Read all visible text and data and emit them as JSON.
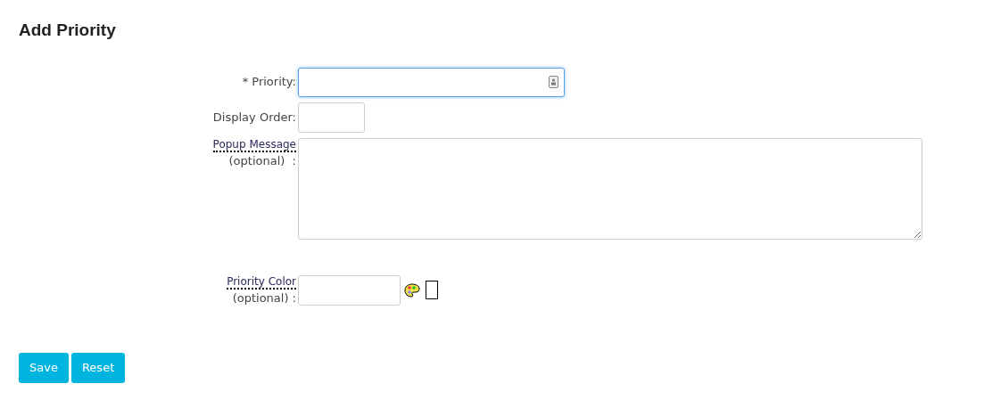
{
  "title": "Add Priority",
  "fields": [
    {
      "kind": "text",
      "label": "* Priority:",
      "focused": true
    },
    {
      "kind": "short",
      "label": "Display Order:",
      "focused": false
    },
    {
      "kind": "textarea",
      "label": "Popup Message",
      "suffix": "(optional)  :",
      "focused": false
    },
    {
      "kind": "color",
      "label": "Priority Color",
      "suffix": "(optional) :",
      "focused": false
    }
  ],
  "buttons": [
    "Save",
    "Reset"
  ]
}
